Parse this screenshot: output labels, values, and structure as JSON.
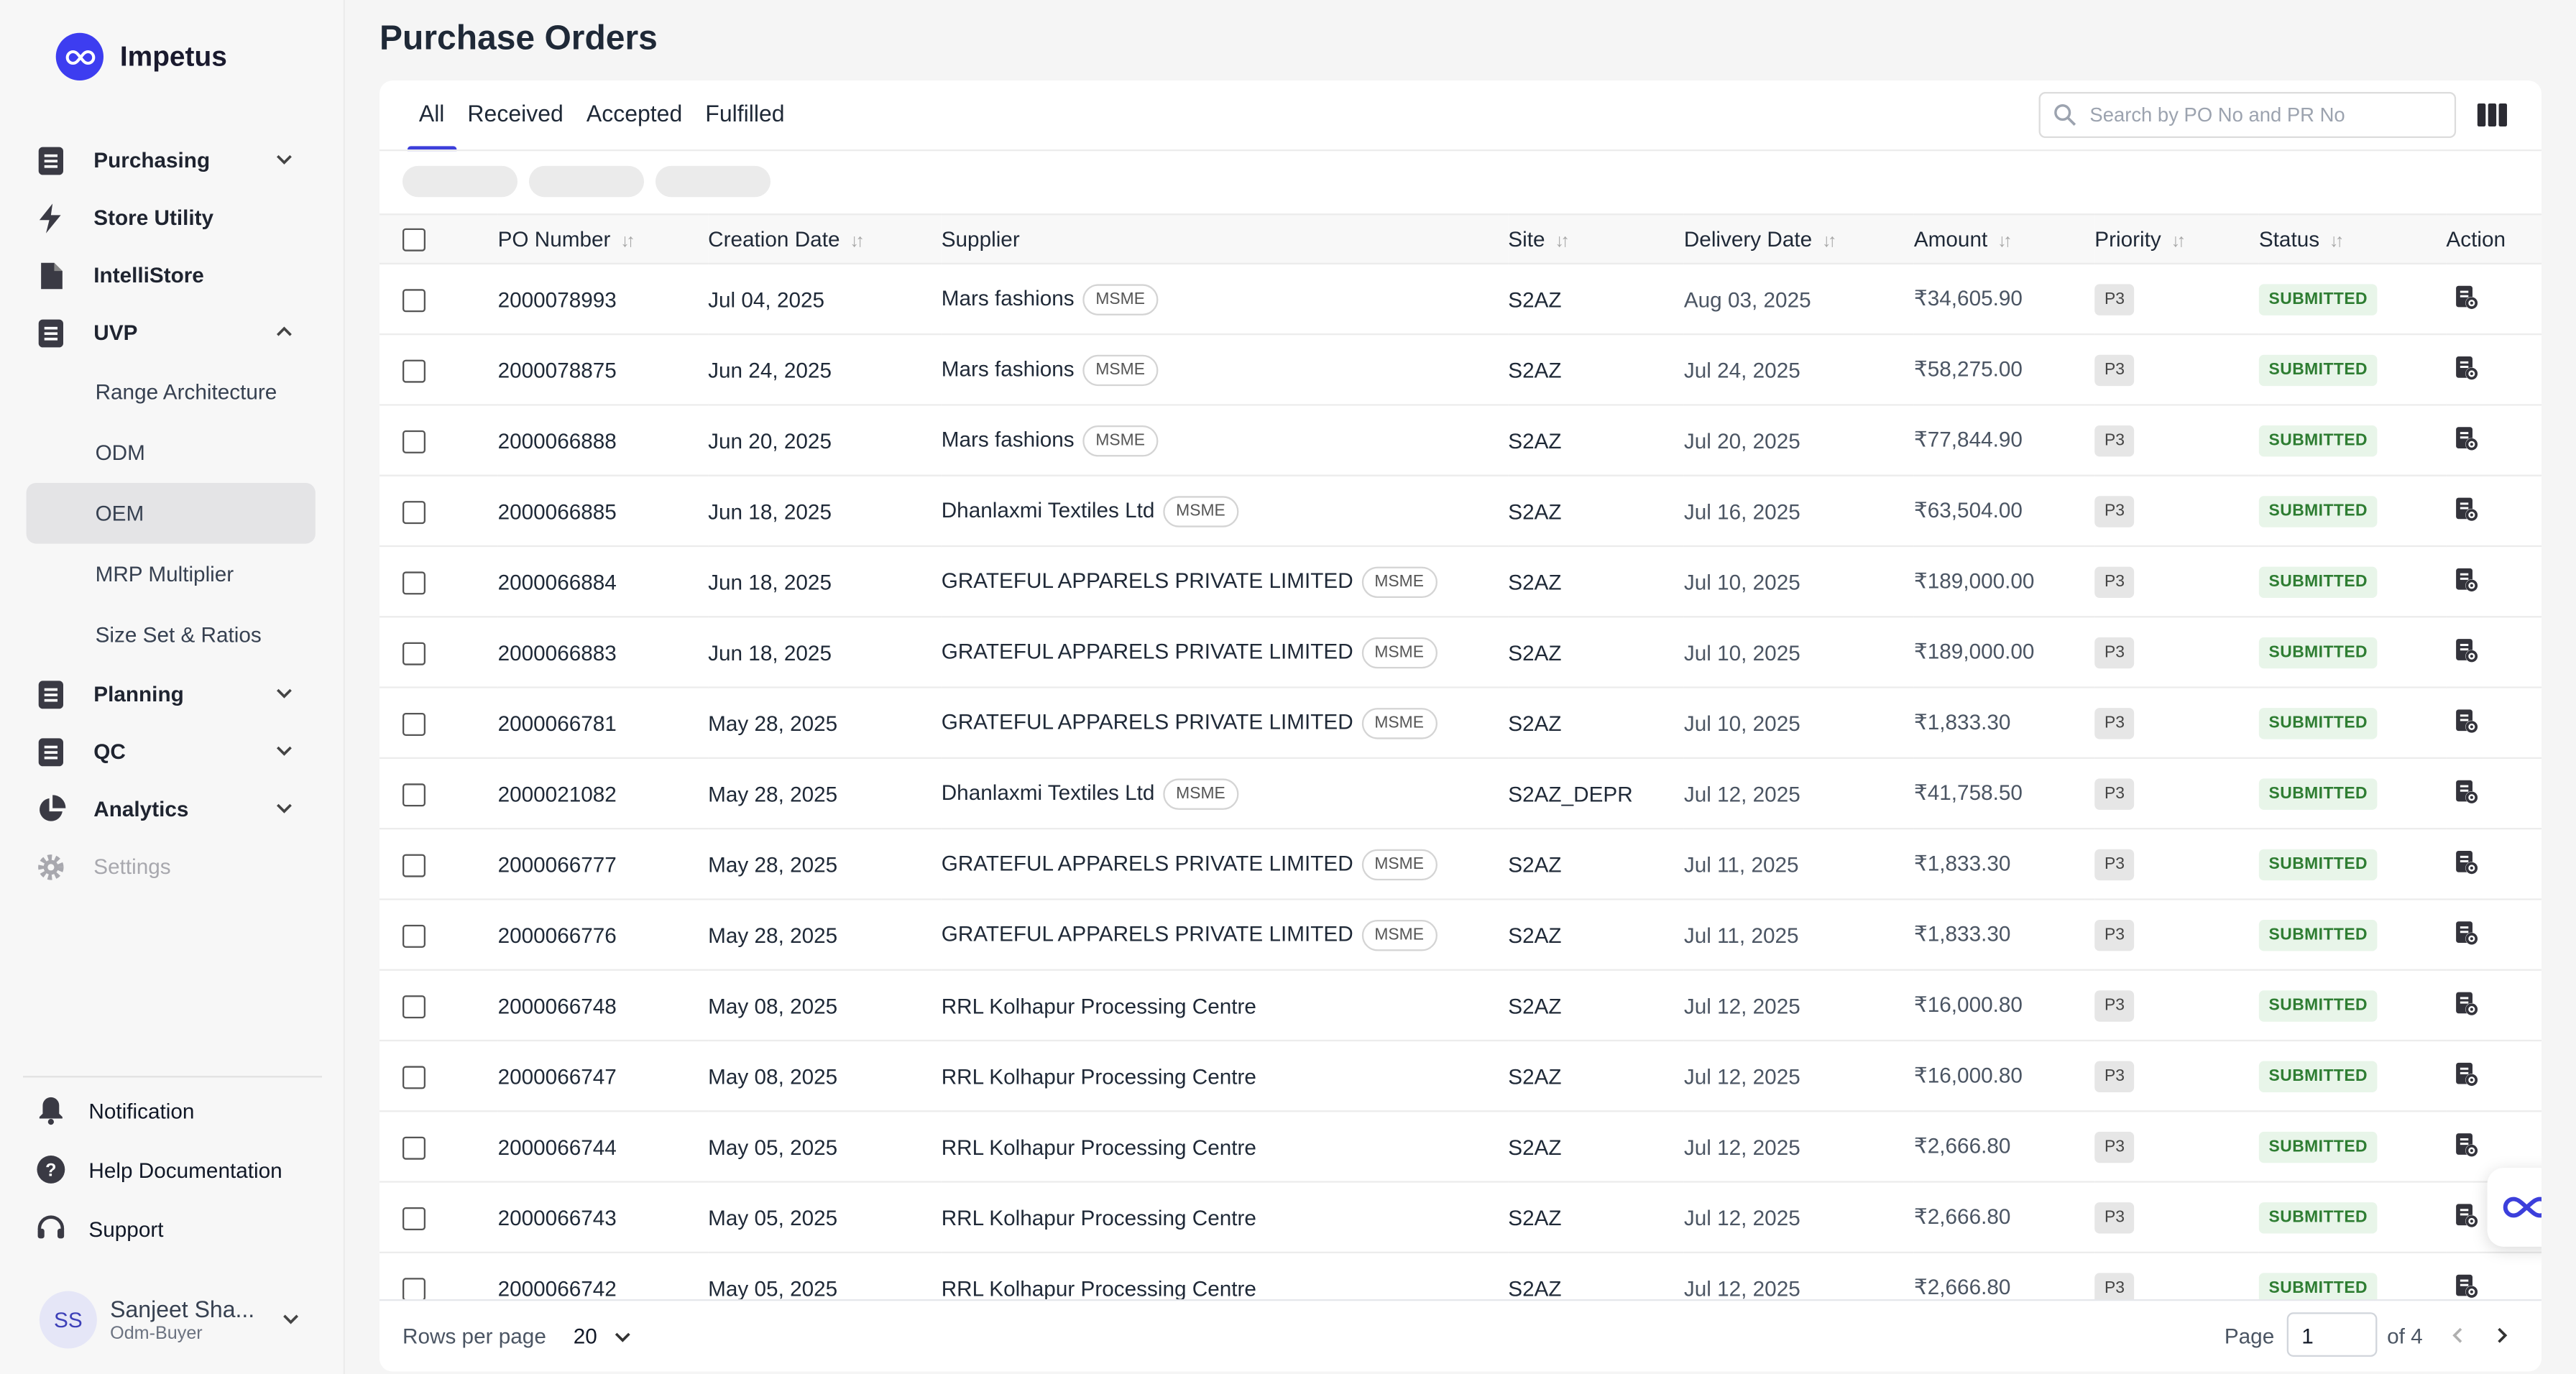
{
  "app": {
    "name": "Impetus"
  },
  "colors": {
    "accent": "#3c3fdb",
    "status_bg": "#e8f5e9",
    "status_text": "#2e7d32"
  },
  "sidebar": {
    "nav": [
      {
        "label": "Purchasing",
        "icon": "document-icon",
        "expanded": false
      },
      {
        "label": "Store Utility",
        "icon": "lightning-icon"
      },
      {
        "label": "IntelliStore",
        "icon": "file-icon"
      },
      {
        "label": "UVP",
        "icon": "document-icon",
        "expanded": true
      }
    ],
    "uvp_sub": [
      {
        "label": "Range Architecture"
      },
      {
        "label": "ODM"
      },
      {
        "label": "OEM",
        "active": true
      },
      {
        "label": "MRP Multiplier"
      },
      {
        "label": "Size Set & Ratios"
      }
    ],
    "nav2": [
      {
        "label": "Planning",
        "icon": "document-icon"
      },
      {
        "label": "QC",
        "icon": "document-icon"
      },
      {
        "label": "Analytics",
        "icon": "pie-chart-icon"
      },
      {
        "label": "Settings",
        "icon": "gear-icon",
        "disabled": true
      }
    ],
    "bottom": [
      {
        "label": "Notification",
        "icon": "bell-icon"
      },
      {
        "label": "Help Documentation",
        "icon": "help-icon"
      },
      {
        "label": "Support",
        "icon": "headset-icon"
      }
    ],
    "user": {
      "initials": "SS",
      "name": "Sanjeet Sha...",
      "role": "Odm-Buyer"
    }
  },
  "page": {
    "title": "Purchase Orders",
    "tabs": [
      "All",
      "Received",
      "Accepted",
      "Fulfilled"
    ],
    "active_tab": "All",
    "search_placeholder": "Search by PO No and PR No"
  },
  "table": {
    "headers": {
      "po": "PO Number",
      "created": "Creation Date",
      "supplier": "Supplier",
      "site": "Site",
      "delivery": "Delivery Date",
      "amount": "Amount",
      "priority": "Priority",
      "status": "Status",
      "action": "Action"
    },
    "rows": [
      {
        "po": "2000078993",
        "created": "Jul 04, 2025",
        "supplier": "Mars fashions",
        "msme": "MSME",
        "site": "S2AZ",
        "delivery": "Aug 03, 2025",
        "amount": "₹34,605.90",
        "priority": "P3",
        "status": "SUBMITTED"
      },
      {
        "po": "2000078875",
        "created": "Jun 24, 2025",
        "supplier": "Mars fashions",
        "msme": "MSME",
        "site": "S2AZ",
        "delivery": "Jul 24, 2025",
        "amount": "₹58,275.00",
        "priority": "P3",
        "status": "SUBMITTED"
      },
      {
        "po": "2000066888",
        "created": "Jun 20, 2025",
        "supplier": "Mars fashions",
        "msme": "MSME",
        "site": "S2AZ",
        "delivery": "Jul 20, 2025",
        "amount": "₹77,844.90",
        "priority": "P3",
        "status": "SUBMITTED"
      },
      {
        "po": "2000066885",
        "created": "Jun 18, 2025",
        "supplier": "Dhanlaxmi Textiles Ltd",
        "msme": "MSME",
        "site": "S2AZ",
        "delivery": "Jul 16, 2025",
        "amount": "₹63,504.00",
        "priority": "P3",
        "status": "SUBMITTED"
      },
      {
        "po": "2000066884",
        "created": "Jun 18, 2025",
        "supplier": "GRATEFUL APPARELS PRIVATE LIMITED",
        "msme": "MSME",
        "site": "S2AZ",
        "delivery": "Jul 10, 2025",
        "amount": "₹189,000.00",
        "priority": "P3",
        "status": "SUBMITTED"
      },
      {
        "po": "2000066883",
        "created": "Jun 18, 2025",
        "supplier": "GRATEFUL APPARELS PRIVATE LIMITED",
        "msme": "MSME",
        "site": "S2AZ",
        "delivery": "Jul 10, 2025",
        "amount": "₹189,000.00",
        "priority": "P3",
        "status": "SUBMITTED"
      },
      {
        "po": "2000066781",
        "created": "May 28, 2025",
        "supplier": "GRATEFUL APPARELS PRIVATE LIMITED",
        "msme": "MSME",
        "site": "S2AZ",
        "delivery": "Jul 10, 2025",
        "amount": "₹1,833.30",
        "priority": "P3",
        "status": "SUBMITTED"
      },
      {
        "po": "2000021082",
        "created": "May 28, 2025",
        "supplier": "Dhanlaxmi Textiles Ltd",
        "msme": "MSME",
        "site": "S2AZ_DEPR",
        "delivery": "Jul 12, 2025",
        "amount": "₹41,758.50",
        "priority": "P3",
        "status": "SUBMITTED"
      },
      {
        "po": "2000066777",
        "created": "May 28, 2025",
        "supplier": "GRATEFUL APPARELS PRIVATE LIMITED",
        "msme": "MSME",
        "site": "S2AZ",
        "delivery": "Jul 11, 2025",
        "amount": "₹1,833.30",
        "priority": "P3",
        "status": "SUBMITTED"
      },
      {
        "po": "2000066776",
        "created": "May 28, 2025",
        "supplier": "GRATEFUL APPARELS PRIVATE LIMITED",
        "msme": "MSME",
        "site": "S2AZ",
        "delivery": "Jul 11, 2025",
        "amount": "₹1,833.30",
        "priority": "P3",
        "status": "SUBMITTED"
      },
      {
        "po": "2000066748",
        "created": "May 08, 2025",
        "supplier": "RRL Kolhapur Processing Centre",
        "msme": "",
        "site": "S2AZ",
        "delivery": "Jul 12, 2025",
        "amount": "₹16,000.80",
        "priority": "P3",
        "status": "SUBMITTED"
      },
      {
        "po": "2000066747",
        "created": "May 08, 2025",
        "supplier": "RRL Kolhapur Processing Centre",
        "msme": "",
        "site": "S2AZ",
        "delivery": "Jul 12, 2025",
        "amount": "₹16,000.80",
        "priority": "P3",
        "status": "SUBMITTED"
      },
      {
        "po": "2000066744",
        "created": "May 05, 2025",
        "supplier": "RRL Kolhapur Processing Centre",
        "msme": "",
        "site": "S2AZ",
        "delivery": "Jul 12, 2025",
        "amount": "₹2,666.80",
        "priority": "P3",
        "status": "SUBMITTED"
      },
      {
        "po": "2000066743",
        "created": "May 05, 2025",
        "supplier": "RRL Kolhapur Processing Centre",
        "msme": "",
        "site": "S2AZ",
        "delivery": "Jul 12, 2025",
        "amount": "₹2,666.80",
        "priority": "P3",
        "status": "SUBMITTED"
      },
      {
        "po": "2000066742",
        "created": "May 05, 2025",
        "supplier": "RRL Kolhapur Processing Centre",
        "msme": "",
        "site": "S2AZ",
        "delivery": "Jul 12, 2025",
        "amount": "₹2,666.80",
        "priority": "P3",
        "status": "SUBMITTED"
      }
    ]
  },
  "footer": {
    "rows_per_page_label": "Rows per page",
    "rows_per_page": "20",
    "page_label": "Page",
    "page": "1",
    "of_label": "of 4"
  }
}
